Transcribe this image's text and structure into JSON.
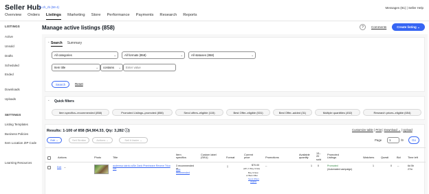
{
  "header": {
    "brand": "Seller Hub",
    "user": "lb.ch_rb (59 4)",
    "messages": "Messages (81)",
    "sep": "|",
    "help": "Seller Help"
  },
  "nav": [
    "Overview",
    "Orders",
    "Listings",
    "Marketing",
    "Store",
    "Performance",
    "Payments",
    "Research",
    "Reports"
  ],
  "sidebar": {
    "listings_head": "LISTINGS",
    "items": [
      "Active",
      "Unsold",
      "Drafts",
      "Scheduled",
      "Ended"
    ],
    "downloads": "Downloads",
    "uploads": "Uploads",
    "settings_head": "SETTINGS",
    "listing_templates": "Listing Templates",
    "business_policies": "Business Policies",
    "item_location": "Item Location ZIP Code",
    "learning": "Learning Resources"
  },
  "page": {
    "title": "Manage active listings (858)",
    "help_glyph": "?",
    "comments": "Comments",
    "create": "Create listing ⌄"
  },
  "search": {
    "tabs": [
      "Search",
      "Summary"
    ],
    "collapse_glyph": "⌃",
    "categories": "All categories",
    "formats": "All formats (858)",
    "statuses": "All statuses (858)",
    "field": "Item title",
    "operator": "contains",
    "placeholder": "Enter value",
    "search_btn": "Search",
    "reset": "Reset",
    "chev": "⌄"
  },
  "quick_filters": {
    "title": "Quick filters",
    "toggle_glyph": "⌃",
    "chips": [
      "Item specifics–recommended (858)",
      "Promoted Listings–promoted (858)",
      "Send offers–eligible (115)",
      "Best Offer–eligible (531)",
      "Best Offer–added (31)",
      "Multiple quantities (452)",
      "Research prices–eligible (654)"
    ]
  },
  "results": {
    "summary": "Results: 1-100 of 858 ($4,904.33, Qty: 3,282 ⓘ)",
    "customize": "Customize table",
    "print": "Print",
    "download": "Download ⌄",
    "upload": "Upload",
    "sep": "|",
    "actions": [
      "Edit ⌄",
      "Sell Similar",
      "Actions ⌄",
      "Sell it faster ⌄"
    ],
    "page_label": "Page",
    "page_value": "1",
    "page_total": "/9",
    "go": "Go"
  },
  "table": {
    "headers": [
      "Actions",
      "Photo",
      "Title",
      "Item specifics",
      "Custom label (SKU)",
      "Format",
      "Current price",
      "Promotions",
      "Available quantity",
      "13–20 sold",
      "Promoted Listings",
      "Watchers",
      "Questi",
      "Bid",
      "Time left"
    ],
    "row": {
      "edit": "Edit",
      "edit_chev": "⌄",
      "title": "audemsa iukrdu a/De Zank Phenheare Reveve Trlca Set",
      "specifics": "3 recommended re...",
      "specifics_add": "Add",
      "specifics_add2": "recomended",
      "format_icon": "▯",
      "price": "$70.00",
      "price_sub": "(2P | X Buy It Not)",
      "best_offer1": "Buy It Now",
      "best_offer2": "or Best Offer",
      "send_offer": "Send Offers",
      "send_offer2": "eligible",
      "promotions": "--",
      "available": "1",
      "sold": "0",
      "promoted": "Promoted",
      "promoted2": "(Automated campaign)",
      "watchers": "1",
      "questions": "0",
      "bid": "--",
      "time": "6d 5h",
      "time2": "27m"
    }
  }
}
